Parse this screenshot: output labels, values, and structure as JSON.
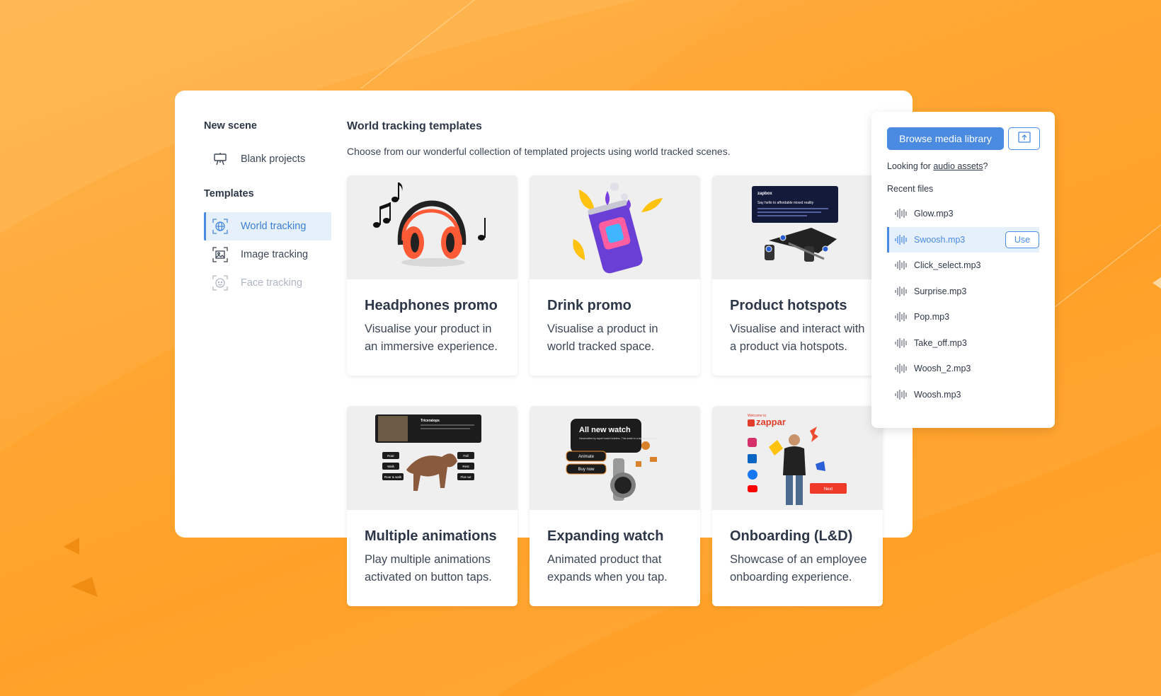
{
  "sidebar": {
    "new_scene_heading": "New scene",
    "blank_projects": "Blank projects",
    "templates_heading": "Templates",
    "items": [
      {
        "label": "World tracking",
        "state": "active"
      },
      {
        "label": "Image tracking",
        "state": "normal"
      },
      {
        "label": "Face tracking",
        "state": "disabled"
      }
    ]
  },
  "content": {
    "title": "World tracking templates",
    "subtitle": "Choose from our wonderful collection of templated projects using world tracked scenes."
  },
  "cards": [
    {
      "title": "Headphones promo",
      "desc": "Visualise your product in an immersive experience.",
      "thumb": "headphones"
    },
    {
      "title": "Drink promo",
      "desc": "Visualise a product in world tracked space.",
      "thumb": "drink-can"
    },
    {
      "title": "Product hotspots",
      "desc": "Visualise and interact with a product via hotspots.",
      "thumb": "headset-hotspots"
    },
    {
      "title": "Multiple animations",
      "desc": "Play multiple animations activated on button taps.",
      "thumb": "dinosaur"
    },
    {
      "title": "Expanding watch",
      "desc": "Animated product that expands when you tap.",
      "thumb": "watch"
    },
    {
      "title": "Onboarding (L&D)",
      "desc": "Showcase of an employee onboarding experience.",
      "thumb": "person"
    }
  ],
  "thumb_text": {
    "zapbox_logo": "zapbox",
    "zapbox_line": "Say hello to affordable mixed reality",
    "dino_title": "Triceratops",
    "dino_buttons": [
      "Roar",
      "Walk",
      "Roar & walk",
      "Fall",
      "Rest",
      "Flat out"
    ],
    "watch_heading": "All new watch",
    "watch_text": "Handcrafted by expert watch builders. This watch is a stylistic perfection.",
    "watch_animate": "Animate",
    "watch_buy": "Buy now",
    "onb_welcome": "Welcome to",
    "onb_brand": "zappar",
    "onb_next": "Next"
  },
  "media": {
    "browse_label": "Browse media library",
    "upload_icon": "upload-icon",
    "looking_prefix": "Looking for ",
    "looking_link": "audio assets",
    "looking_suffix": "?",
    "recent_label": "Recent files",
    "use_label": "Use",
    "files": [
      {
        "name": "Glow.mp3",
        "active": false
      },
      {
        "name": "Swoosh.mp3",
        "active": true
      },
      {
        "name": "Click_select.mp3",
        "active": false
      },
      {
        "name": "Surprise.mp3",
        "active": false
      },
      {
        "name": "Pop.mp3",
        "active": false
      },
      {
        "name": "Take_off.mp3",
        "active": false
      },
      {
        "name": "Woosh_2.mp3",
        "active": false
      },
      {
        "name": "Woosh.mp3",
        "active": false
      }
    ]
  },
  "colors": {
    "accent": "#4a8ae0",
    "background": "#ffa632",
    "active_bg": "#e6f0fb"
  }
}
